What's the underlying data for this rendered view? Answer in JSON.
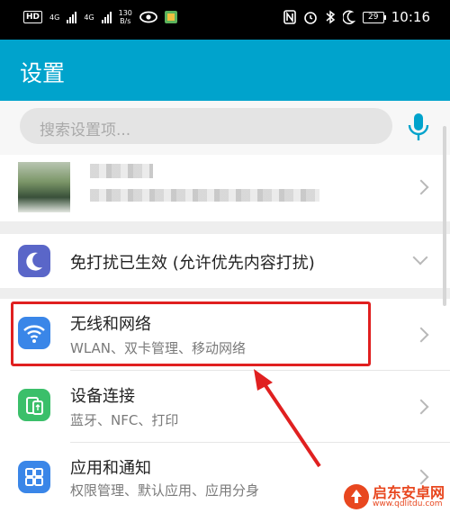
{
  "status_bar": {
    "hd": "HD",
    "sim1": "4G",
    "sim2": "4G",
    "speed_value": "130",
    "speed_unit": "B/s",
    "battery": "29",
    "time": "10:16"
  },
  "header": {
    "title": "设置",
    "color": "#00a3cc"
  },
  "search": {
    "placeholder": "搜索设置项..."
  },
  "rows": [
    {
      "title": "免打扰已生效 (允许优先内容打扰)",
      "subtitle": ""
    },
    {
      "title": "无线和网络",
      "subtitle": "WLAN、双卡管理、移动网络"
    },
    {
      "title": "设备连接",
      "subtitle": "蓝牙、NFC、打印"
    },
    {
      "title": "应用和通知",
      "subtitle": "权限管理、默认应用、应用分身"
    }
  ],
  "watermark": {
    "title": "启东安卓网",
    "url": "www.qdlitdu.com"
  },
  "colors": {
    "annotation": "#e02020",
    "accent": "#00a3cc"
  }
}
